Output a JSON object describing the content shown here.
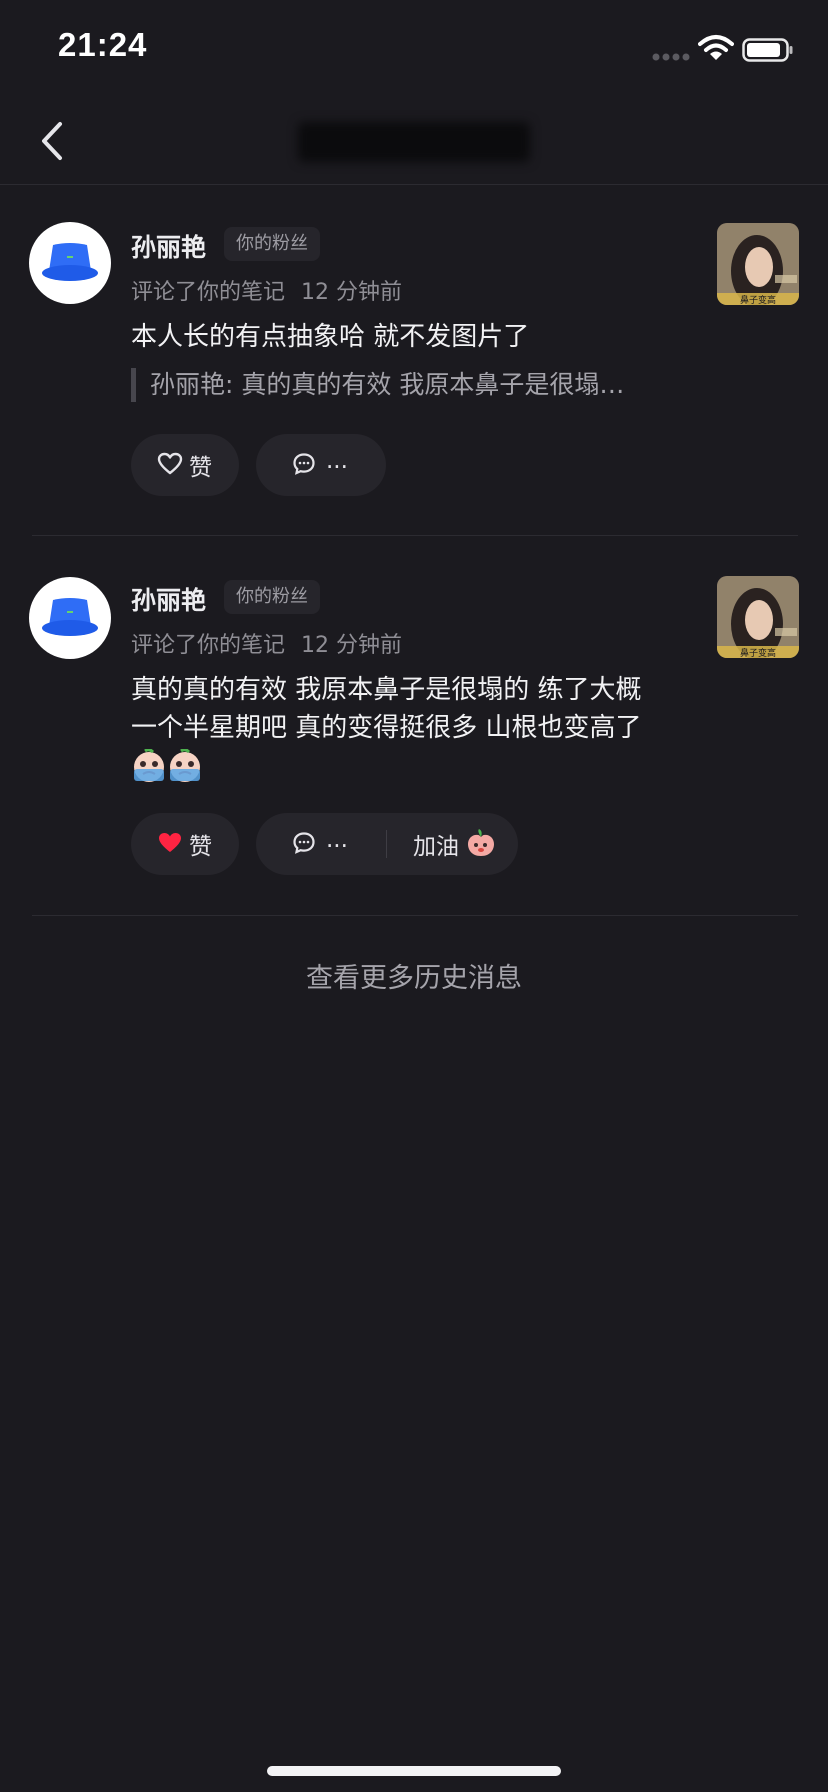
{
  "status": {
    "time": "21:24"
  },
  "nav": {
    "back_icon": "chevron-left-icon",
    "title": ""
  },
  "notifications": [
    {
      "user": "孙丽艳",
      "badge": "你的粉丝",
      "action": "评论了你的笔记",
      "time": "12 分钟前",
      "text": "本人长的有点抽象哈 就不发图片了",
      "quote": "孙丽艳: 真的真的有效 我原本鼻子是很塌…",
      "like_label": "赞",
      "liked": false,
      "reply_label": "...",
      "thumb_caption": "鼻子变高"
    },
    {
      "user": "孙丽艳",
      "badge": "你的粉丝",
      "action": "评论了你的笔记",
      "time": "12 分钟前",
      "text_line1": "真的真的有效 我原本鼻子是很塌的 练了大概",
      "text_line2": "一个半星期吧 真的变得挺很多 山根也变高了",
      "like_label": "赞",
      "liked": true,
      "reply_label": "...",
      "cheer_label": "加油",
      "thumb_caption": "鼻子变高"
    }
  ],
  "footer": {
    "more_history": "查看更多历史消息"
  },
  "colors": {
    "background": "#1b1a1f",
    "pill": "#26252b",
    "like_red": "#ff2442"
  }
}
